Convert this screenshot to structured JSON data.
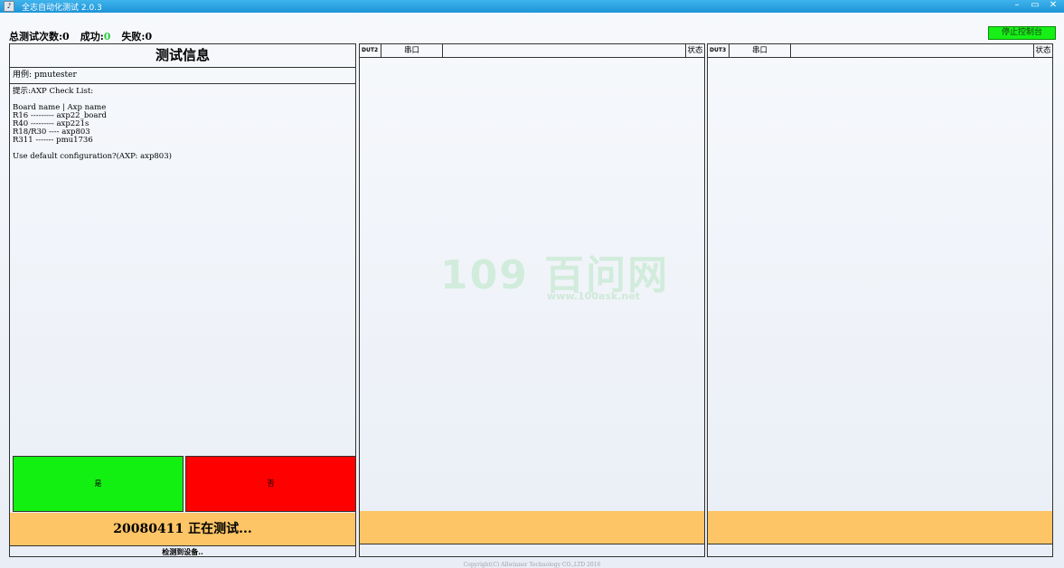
{
  "window": {
    "title": "全志自动化测试 2.0.3",
    "controls": [
      "–",
      "▭",
      "✕"
    ]
  },
  "stats": {
    "total_label": "总测试次数:0",
    "success_label": "成功:",
    "success_value": "0",
    "fail_label": "失败:0"
  },
  "stop_button": "停止控制台",
  "left_panel": {
    "title": "测试信息",
    "case": "用例:   pmutester",
    "info_text": "提示:AXP Check List:\n\nBoard name | Axp name\nR16 --------- axp22_board\nR40 --------- axp221s\nR18/R30 ---- axp803\nR311 ------- pmu1736\n\nUse default configuration?(AXP: axp803)",
    "yes_button": "是",
    "no_button": "否",
    "status": "20080411 正在测试...",
    "detect": "检测到设备.."
  },
  "dut_panels": [
    {
      "id": "DUT2",
      "port": "串口",
      "state": "状态"
    },
    {
      "id": "DUT3",
      "port": "串口",
      "state": "状态"
    }
  ],
  "watermark": {
    "big": "109 百问网",
    "small": "www.100ask.net"
  },
  "copyright": "Copyright(C) Allwinner Technology CO.,LTD 2016",
  "colors": {
    "titlebar": "#1d95d8",
    "stop_button": "#16f016",
    "yes": "#12f012",
    "no": "#fe0000",
    "status_bar": "#fdc566",
    "success_value": "#2ecc40"
  }
}
